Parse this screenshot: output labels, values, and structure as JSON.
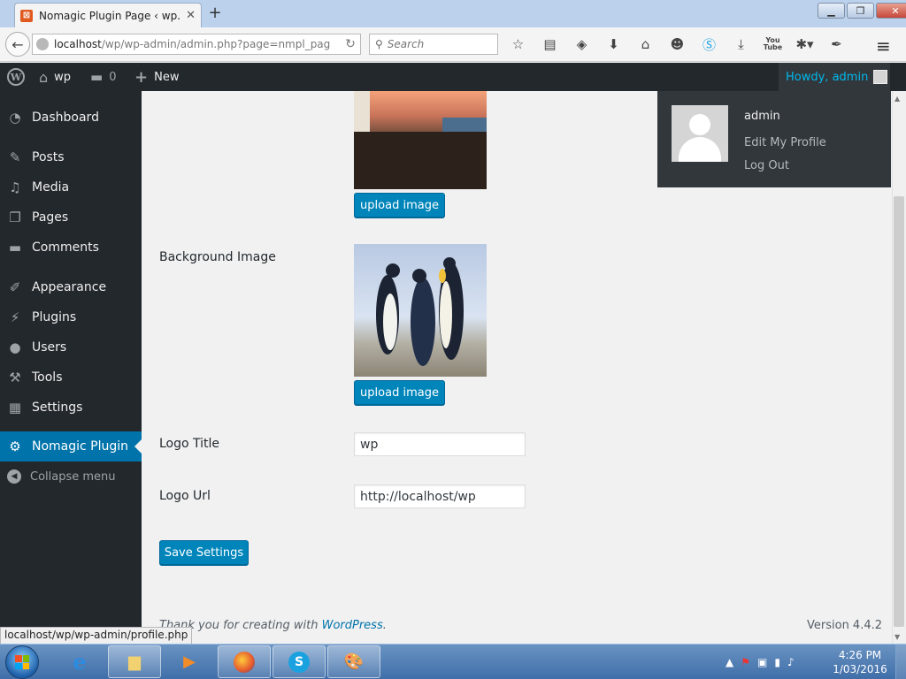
{
  "browser": {
    "tab_title": "Nomagic Plugin Page ‹ wp...",
    "url_host": "localhost",
    "url_path": "/wp/wp-admin/admin.php?page=nmpl_pag",
    "search_placeholder": "Search"
  },
  "adminbar": {
    "site_name": "wp",
    "comments_count": "0",
    "new_label": "New",
    "howdy": "Howdy, admin"
  },
  "account_menu": {
    "username": "admin",
    "edit_profile": "Edit My Profile",
    "logout": "Log Out"
  },
  "sidebar": {
    "items": [
      {
        "label": "Dashboard",
        "icon": "dashboard-icon"
      },
      {
        "label": "Posts",
        "icon": "pin-icon"
      },
      {
        "label": "Media",
        "icon": "media-icon"
      },
      {
        "label": "Pages",
        "icon": "pages-icon"
      },
      {
        "label": "Comments",
        "icon": "comment-icon"
      },
      {
        "label": "Appearance",
        "icon": "brush-icon"
      },
      {
        "label": "Plugins",
        "icon": "plug-icon"
      },
      {
        "label": "Users",
        "icon": "user-icon"
      },
      {
        "label": "Tools",
        "icon": "wrench-icon"
      },
      {
        "label": "Settings",
        "icon": "settings-icon"
      },
      {
        "label": "Nomagic Plugin",
        "icon": "gear-icon"
      }
    ],
    "collapse_label": "Collapse menu"
  },
  "form": {
    "upload_label": "upload image",
    "background_label": "Background Image",
    "logo_title_label": "Logo Title",
    "logo_title_value": "wp",
    "logo_url_label": "Logo Url",
    "logo_url_value": "http://localhost/wp",
    "save_label": "Save Settings"
  },
  "footer": {
    "thanks": "Thank you for creating with",
    "wp_link": "WordPress",
    "version": "Version 4.4.2"
  },
  "status_link": "localhost/wp/wp-admin/profile.php",
  "taskbar": {
    "time": "4:26 PM",
    "date": "1/03/2016"
  },
  "colors": {
    "admin_bg": "#23282d",
    "accent": "#0073aa",
    "button": "#0085ba",
    "link_highlight": "#00b9eb"
  }
}
